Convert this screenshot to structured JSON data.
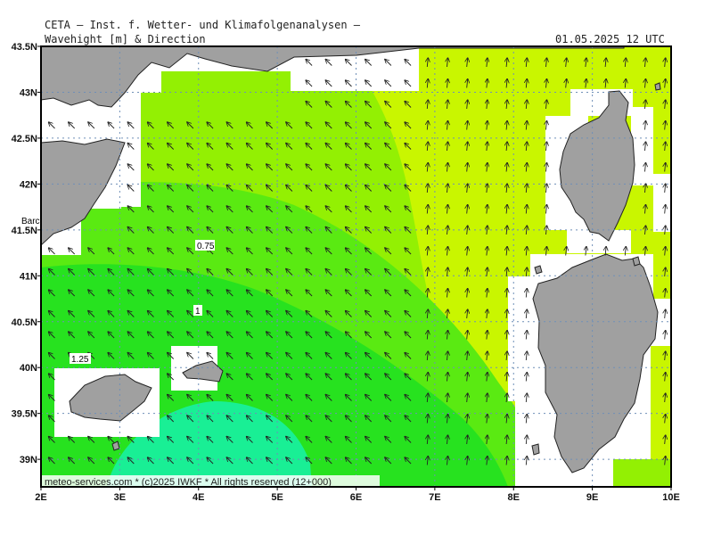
{
  "header": {
    "institution": "CETA — Inst. f. Wetter- und Klimafolgenanalysen —",
    "product": "Wavehight [m] & Direction",
    "valid_time": "01.05.2025 12 UTC"
  },
  "map": {
    "lon_range": [
      2,
      10
    ],
    "lat_range": [
      38.7,
      43.5
    ],
    "lon_ticks": [
      "2E",
      "3E",
      "4E",
      "5E",
      "6E",
      "7E",
      "8E",
      "9E",
      "10E"
    ],
    "lat_ticks": [
      "43.5N",
      "43N",
      "42.5N",
      "42N",
      "41.5N",
      "41N",
      "40.5N",
      "40N",
      "39.5N",
      "39N"
    ],
    "city_label": "Barc",
    "contour_labels": [
      "0.75",
      "1",
      "1.25"
    ],
    "footer": "meteo-services.com * (c)2025 IWKF * All rights reserved (12+000)",
    "legend_colors": {
      "1.25": "#19ef95",
      "1.0": "#27e21f",
      "0.75": "#5aea12",
      "0.5": "#93f003",
      "0.25": "#c9f600",
      "land": "#a0a0a0"
    },
    "wave_direction": "from south-east, arrows pointing north-west"
  }
}
